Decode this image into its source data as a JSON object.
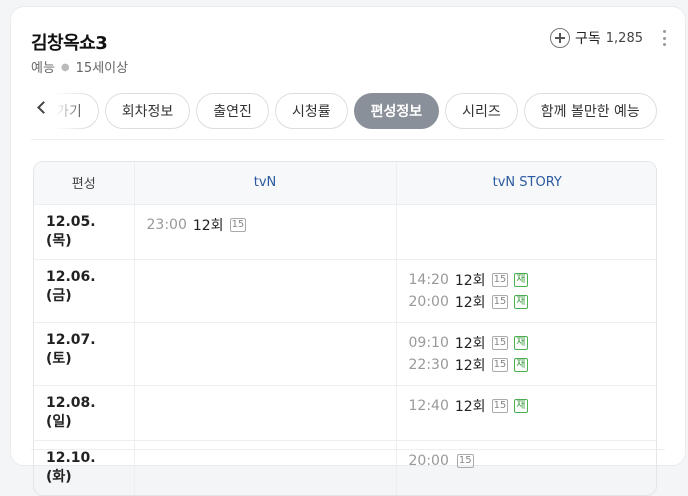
{
  "program": {
    "title": "김창옥쇼3",
    "genre": "예능",
    "rating": "15세이상",
    "subscribe_label": "구독",
    "subscribe_count": "1,285"
  },
  "tabs": [
    {
      "label": "가기",
      "active": false
    },
    {
      "label": "회차정보",
      "active": false
    },
    {
      "label": "출연진",
      "active": false
    },
    {
      "label": "시청률",
      "active": false
    },
    {
      "label": "편성정보",
      "active": true
    },
    {
      "label": "시리즈",
      "active": false
    },
    {
      "label": "함께 볼만한 예능",
      "active": false
    }
  ],
  "schedule": {
    "header": [
      "편성",
      "tvN",
      "tvN STORY"
    ],
    "rows": [
      {
        "date": "12.05. (목)",
        "tvn": [
          {
            "time": "23:00",
            "episode": "12회",
            "age": "15",
            "rerun": ""
          }
        ],
        "story": []
      },
      {
        "date": "12.06. (금)",
        "tvn": [],
        "story": [
          {
            "time": "14:20",
            "episode": "12회",
            "age": "15",
            "rerun": "재"
          },
          {
            "time": "20:00",
            "episode": "12회",
            "age": "15",
            "rerun": "재"
          }
        ]
      },
      {
        "date": "12.07. (토)",
        "tvn": [],
        "story": [
          {
            "time": "09:10",
            "episode": "12회",
            "age": "15",
            "rerun": "재"
          },
          {
            "time": "22:30",
            "episode": "12회",
            "age": "15",
            "rerun": "재"
          }
        ]
      },
      {
        "date": "12.08. (일)",
        "tvn": [],
        "story": [
          {
            "time": "12:40",
            "episode": "12회",
            "age": "15",
            "rerun": "재"
          }
        ]
      },
      {
        "date": "12.10. (화)",
        "tvn": [],
        "story": [
          {
            "time": "20:00",
            "episode": "",
            "age": "15",
            "rerun": ""
          }
        ]
      }
    ]
  }
}
